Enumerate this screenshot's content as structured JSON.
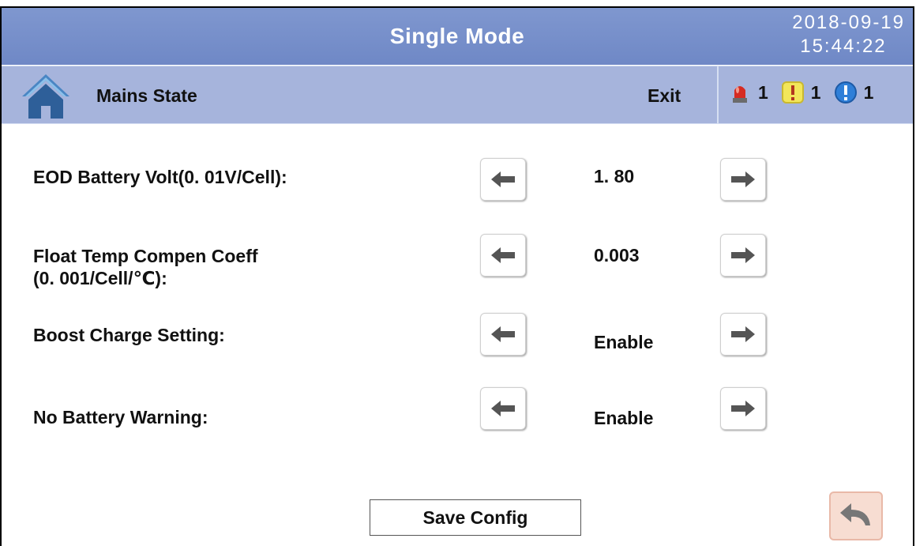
{
  "header": {
    "title": "Single Mode",
    "date": "2018-09-19",
    "time": "15:44:22"
  },
  "subheader": {
    "home_icon": "home-icon",
    "state_label": "Mains State",
    "exit_label": "Exit",
    "alarms": [
      {
        "icon": "siren-icon",
        "count": "1",
        "color": "#d62b22"
      },
      {
        "icon": "warning-icon",
        "count": "1",
        "color": "#f2e65a"
      },
      {
        "icon": "info-icon",
        "count": "1",
        "color": "#2f7fd8"
      }
    ]
  },
  "settings": [
    {
      "label": "EOD Battery Volt(0. 01V/Cell):",
      "value": "1. 80"
    },
    {
      "label_line1": "Float Temp Compen Coeff",
      "label_line2": "(0. 001/Cell/℃):",
      "value": "0.003"
    },
    {
      "label": "Boost Charge Setting:",
      "value": "Enable"
    },
    {
      "label": "No Battery Warning:",
      "value": "Enable"
    }
  ],
  "footer": {
    "save_label": "Save Config",
    "back_icon": "back-arrow-icon"
  },
  "colors": {
    "header_bg": "#7f97cf",
    "subheader_bg": "#a6b4dc",
    "home_icon": "#2e6aa8",
    "back_button_bg": "#f7ddd2"
  }
}
